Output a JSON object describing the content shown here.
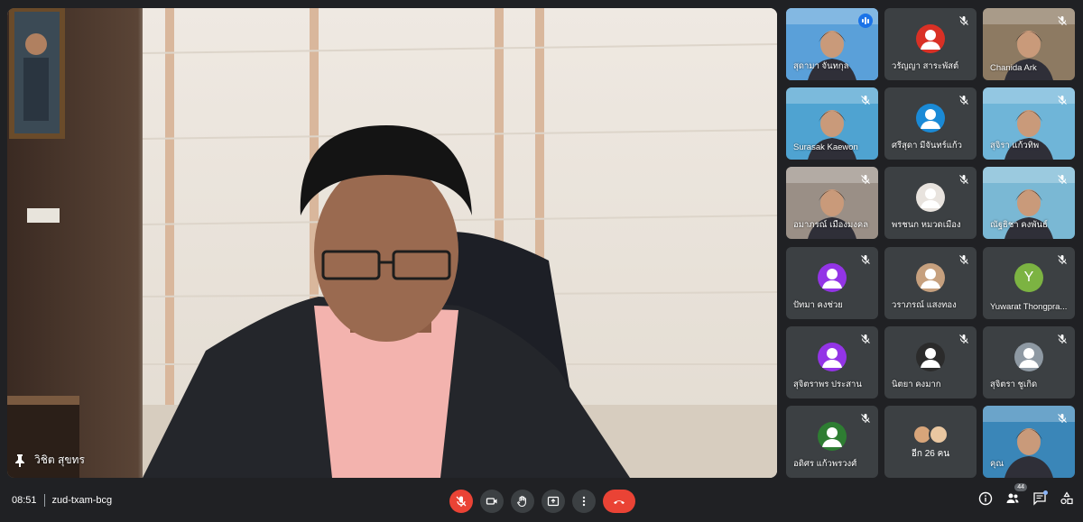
{
  "meeting": {
    "time": "08:51",
    "code": "zud-txam-bcg"
  },
  "main_speaker": {
    "name": "วิชิต สุขทร"
  },
  "participants": [
    {
      "name": "สุดามา จันทกุล",
      "type": "video",
      "speaking": true,
      "bg": "#5aa0d9"
    },
    {
      "name": "วรัญญา สาระพัสต์",
      "type": "avatar",
      "initial": "",
      "color": "#d93025"
    },
    {
      "name": "Chanida Ark",
      "type": "video",
      "bg": "#8d7a62"
    },
    {
      "name": "Surasak Kaewon",
      "type": "video",
      "bg": "#4fa3d1"
    },
    {
      "name": "ศรีสุดา มีจันทร์แก้ว",
      "type": "avatar",
      "initial": "",
      "color": "#1a8ad6"
    },
    {
      "name": "สุจิรา แก้วทิพ",
      "type": "video",
      "bg": "#6fb5d8"
    },
    {
      "name": "อมาภรณ์ เมืองมงคล",
      "type": "video",
      "bg": "#9a8f86"
    },
    {
      "name": "พรชนก หมวดเมือง",
      "type": "avatar",
      "initial": "",
      "color": "#e8e3de"
    },
    {
      "name": "ณัฐธิชา คงพันธ์",
      "type": "video",
      "bg": "#7ab8d4"
    },
    {
      "name": "ปัทมา คงช่วย",
      "type": "avatar",
      "initial": "",
      "color": "#9334e6"
    },
    {
      "name": "วราภรณ์ แสงทอง",
      "type": "avatar",
      "initial": "",
      "color": "#c6a07e"
    },
    {
      "name": "Yuwarat Thongpra...",
      "type": "avatar",
      "initial": "Y",
      "color": "#7cb342"
    },
    {
      "name": "สุจิตราพร ประสาน",
      "type": "avatar",
      "initial": "",
      "color": "#9334e6"
    },
    {
      "name": "นิตยา คงมาก",
      "type": "avatar",
      "initial": "",
      "color": "#2b2b2b"
    },
    {
      "name": "สุจิตรา ชูเกิด",
      "type": "avatar",
      "initial": "",
      "color": "#8e99a3"
    },
    {
      "name": "อดิศร แก้วพรวงศ์",
      "type": "avatar",
      "initial": "",
      "color": "#2e7d32"
    },
    {
      "name": "อีก 26 คน",
      "type": "others"
    },
    {
      "name": "คุณ",
      "type": "video",
      "bg": "#3a86b8"
    }
  ],
  "people_count": "44",
  "icons": {
    "mic": "mic-off-icon",
    "camera": "camera-icon",
    "hand": "raise-hand-icon",
    "present": "present-screen-icon",
    "more": "more-options-icon",
    "end": "end-call-icon",
    "info": "info-icon",
    "people": "people-icon",
    "chat": "chat-icon",
    "activities": "activities-icon"
  },
  "colors": {
    "accent": "#8ab4f8",
    "danger": "#ea4335",
    "bar": "#202124",
    "tile": "#3c4043"
  }
}
